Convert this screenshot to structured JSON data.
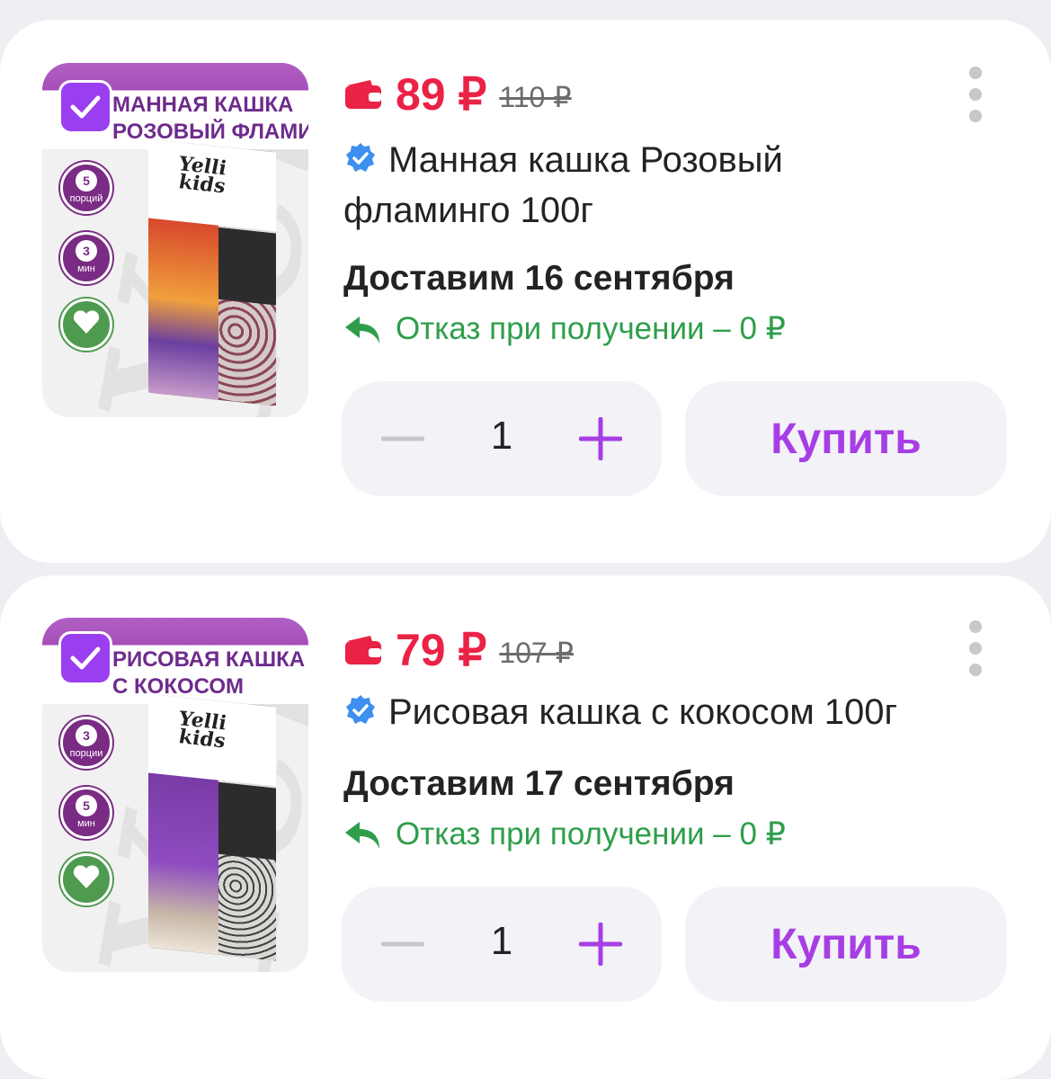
{
  "products": [
    {
      "price": "89 ₽",
      "old_price": "110 ₽",
      "title": "Манная кашка Розовый фламинго 100г",
      "image_banner": "МАННАЯ КАШКА\nРОЗОВЫЙ ФЛАМИНГО",
      "badge_portions": "5",
      "badge_portions_unit": "порций",
      "badge_minutes": "3",
      "badge_minutes_unit": "мин",
      "brand": "Yelli kids",
      "delivery": "Доставим 16 сентября",
      "refund": "Отказ при получении – 0 ₽",
      "quantity": "1",
      "buy_label": "Купить",
      "selected": true
    },
    {
      "price": "79 ₽",
      "old_price": "107 ₽",
      "title": "Рисовая кашка с кокосом 100г",
      "image_banner": "РИСОВАЯ КАШКА\nС КОКОСОМ",
      "badge_portions": "3",
      "badge_portions_unit": "порции",
      "badge_minutes": "5",
      "badge_minutes_unit": "мин",
      "brand": "Yelli kids",
      "delivery": "Доставим 17 сентября",
      "refund": "Отказ при получении – 0 ₽",
      "quantity": "1",
      "buy_label": "Купить",
      "selected": true
    }
  ],
  "colors": {
    "price": "#ea2246",
    "accent": "#a73ee4",
    "checkbox": "#9a3ff0",
    "refund": "#2e9e4b",
    "verified": "#3d8ff0"
  },
  "icons": [
    "wallet-icon",
    "verified-icon",
    "return-arrow-icon",
    "minus-icon",
    "plus-icon",
    "more-vertical-icon",
    "checkmark-icon"
  ]
}
